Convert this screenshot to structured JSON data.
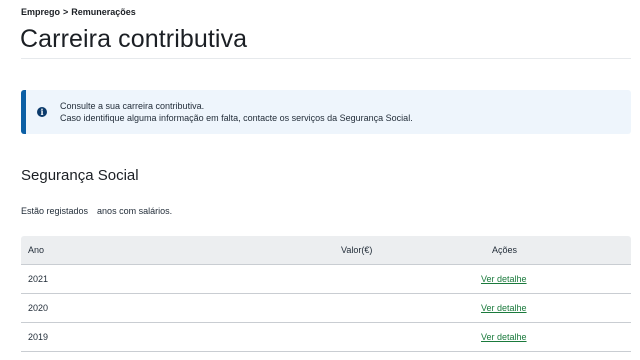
{
  "breadcrumb": {
    "items": [
      "Emprego",
      "Remunerações"
    ],
    "separator": ">"
  },
  "page": {
    "title": "Carreira contributiva"
  },
  "info": {
    "icon": "info-icon",
    "line1": "Consulte a sua carreira contributiva.",
    "line2": "Caso identifique alguma informação em falta, contacte os serviços da Segurança Social.",
    "accent_color": "#0b5fa5"
  },
  "section": {
    "title": "Segurança Social",
    "summary_prefix": "Estão registados",
    "summary_suffix": "anos com salários."
  },
  "table": {
    "columns": [
      "Ano",
      "Valor(€)",
      "Ações"
    ],
    "rows": [
      {
        "year": "2021",
        "action": "Ver detalhe"
      },
      {
        "year": "2020",
        "action": "Ver detalhe"
      },
      {
        "year": "2019",
        "action": "Ver detalhe"
      }
    ],
    "link_color": "#1a7a3c"
  }
}
